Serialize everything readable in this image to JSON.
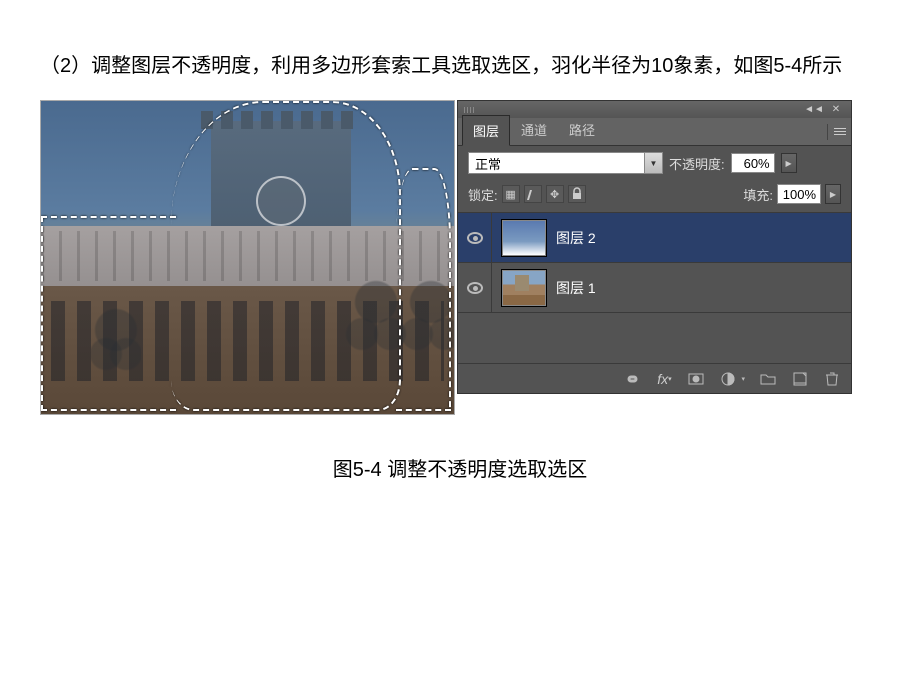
{
  "instruction": "（2）调整图层不透明度，利用多边形套索工具选取选区，羽化半径为10象素，如图5-4所示",
  "panel": {
    "tabs": [
      "图层",
      "通道",
      "路径"
    ],
    "active_tab": "图层",
    "blend_mode": "正常",
    "opacity_label": "不透明度:",
    "opacity_value": "60%",
    "lock_label": "锁定:",
    "fill_label": "填充:",
    "fill_value": "100%",
    "layers": [
      {
        "name": "图层 2",
        "visible": true,
        "selected": true
      },
      {
        "name": "图层 1",
        "visible": true,
        "selected": false
      }
    ]
  },
  "caption": "图5-4 调整不透明度选取选区"
}
